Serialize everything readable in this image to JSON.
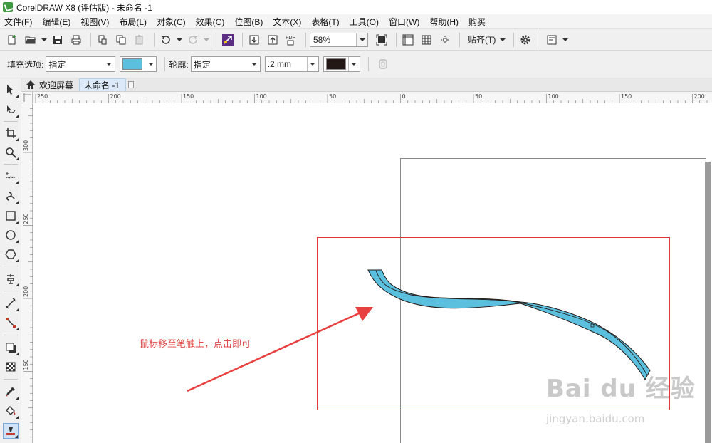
{
  "window": {
    "title": "CorelDRAW X8 (评估版) - 未命名 -1"
  },
  "menu": [
    "文件(F)",
    "编辑(E)",
    "视图(V)",
    "布局(L)",
    "对象(C)",
    "效果(C)",
    "位图(B)",
    "文本(X)",
    "表格(T)",
    "工具(O)",
    "窗口(W)",
    "帮助(H)",
    "购买"
  ],
  "toolbar": {
    "zoom": "58%",
    "snap_label": "贴齐(T)",
    "pdf_label": "PDF"
  },
  "property_bar": {
    "fill_label": "填充选项:",
    "fill_value": "指定",
    "outline_label": "轮廓:",
    "outline_value": "指定",
    "outline_width": ".2 mm"
  },
  "colors": {
    "fill": "#5bc0de",
    "outline": "#231815",
    "selection": "#e03a3a",
    "annotation": "#e04848"
  },
  "tabs": [
    {
      "label": "欢迎屏幕"
    },
    {
      "label": "未命名 -1"
    }
  ],
  "hruler": {
    "labels": [
      "250",
      "200",
      "150",
      "100",
      "50",
      "0",
      "50",
      "100",
      "150",
      "200"
    ]
  },
  "vruler": {
    "labels": [
      "300",
      "250",
      "200",
      "150"
    ]
  },
  "annotation": {
    "text": "鼠标移至笔触上，点击即可"
  },
  "watermark": {
    "logo": "Bai du 经验",
    "url": "jingyan.baidu.com"
  }
}
